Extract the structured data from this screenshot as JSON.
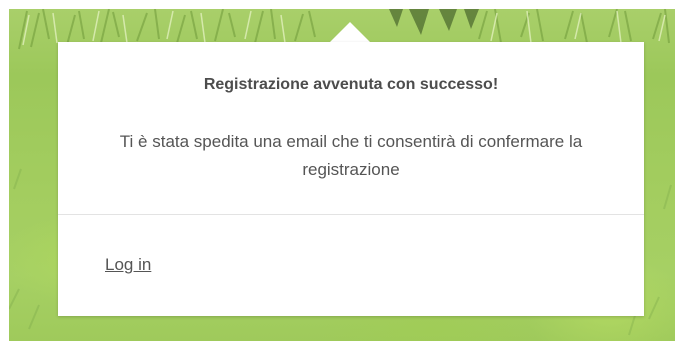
{
  "dialog": {
    "title": "Registrazione avvenuta con successo!",
    "message": "Ti è stata spedita una email che ti consentirà di confermare la registrazione",
    "login_link": "Log in"
  },
  "colors": {
    "background_grass": "#a3cd5f",
    "card": "#ffffff",
    "text": "#555555"
  }
}
